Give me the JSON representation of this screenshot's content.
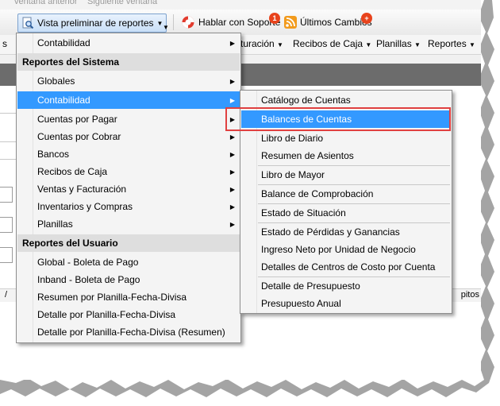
{
  "top_strip": {
    "prev": "ventana anterior",
    "next": "Siguiente ventana"
  },
  "toolbar": {
    "preview_label": "Vista preliminar de reportes",
    "support_label": "Hablar con Soporte",
    "support_badge": "1",
    "changes_label": "Últimos Cambios",
    "changes_badge": "+"
  },
  "menubar": {
    "items": [
      {
        "label": "s"
      },
      {
        "label": "turación"
      },
      {
        "label": "Recibos de Caja"
      },
      {
        "label": "Planillas"
      },
      {
        "label": "Reportes"
      }
    ]
  },
  "status": {
    "left": "/",
    "right": "pitos"
  },
  "main_menu": {
    "top_item": "Contabilidad",
    "system_header": "Reportes del Sistema",
    "system_items": [
      {
        "label": "Globales"
      },
      {
        "label": "Contabilidad"
      },
      {
        "label": "Cuentas por Pagar"
      },
      {
        "label": "Cuentas por Cobrar"
      },
      {
        "label": "Bancos"
      },
      {
        "label": "Recibos de Caja"
      },
      {
        "label": "Ventas y Facturación"
      },
      {
        "label": "Inventarios y Compras"
      },
      {
        "label": "Planillas"
      }
    ],
    "user_header": "Reportes del Usuario",
    "user_items": [
      {
        "label": "Global - Boleta de Pago"
      },
      {
        "label": "Inband - Boleta de Pago"
      },
      {
        "label": "Resumen por Planilla-Fecha-Divisa"
      },
      {
        "label": "Detalle por Planilla-Fecha-Divisa"
      },
      {
        "label": "Detalle por Planilla-Fecha-Divisa (Resumen)"
      }
    ]
  },
  "submenu": {
    "items": [
      {
        "label": "Catálogo de Cuentas"
      },
      {
        "label": "Balances de Cuentas"
      },
      {
        "label": "Libro de Diario"
      },
      {
        "label": "Resumen de Asientos"
      },
      {
        "label": "Libro de Mayor"
      },
      {
        "label": "Balance de Comprobación"
      },
      {
        "label": "Estado de Situación"
      },
      {
        "label": "Estado de Pérdidas y Ganancias"
      },
      {
        "label": "Ingreso Neto por Unidad de Negocio"
      },
      {
        "label": "Detalles de Centros de Costo por Cuenta"
      },
      {
        "label": "Detalle de Presupuesto"
      },
      {
        "label": "Presupuesto Anual"
      }
    ],
    "selected": "Balances de Cuentas"
  },
  "colors": {
    "highlight": "#3399ff",
    "annotation": "#e04040",
    "badge": "#e8431c"
  }
}
